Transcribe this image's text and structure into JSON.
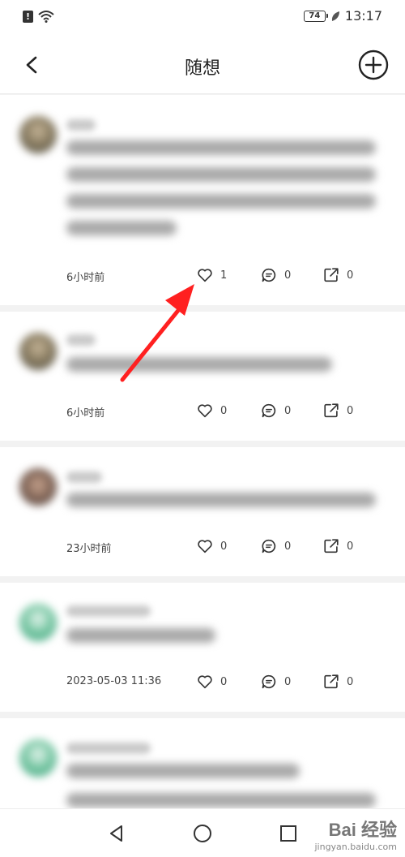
{
  "status_bar": {
    "battery": "74",
    "time": "13:17"
  },
  "header": {
    "title": "随想"
  },
  "posts": [
    {
      "time": "6小时前",
      "likes": "1",
      "comments": "0",
      "shares": "0"
    },
    {
      "time": "6小时前",
      "likes": "0",
      "comments": "0",
      "shares": "0"
    },
    {
      "time": "23小时前",
      "likes": "0",
      "comments": "0",
      "shares": "0"
    },
    {
      "time": "2023-05-03 11:36",
      "likes": "0",
      "comments": "0",
      "shares": "0"
    }
  ],
  "icons": {
    "back": "back-arrow-icon",
    "add": "add-circle-icon",
    "like": "heart-icon",
    "comment": "comment-icon",
    "share": "share-icon",
    "annotation": "red-arrow"
  },
  "colors": {
    "annotation_arrow": "#ff2020"
  },
  "watermark": {
    "brand": "Bai 经验",
    "url": "jingyan.baidu.com"
  }
}
